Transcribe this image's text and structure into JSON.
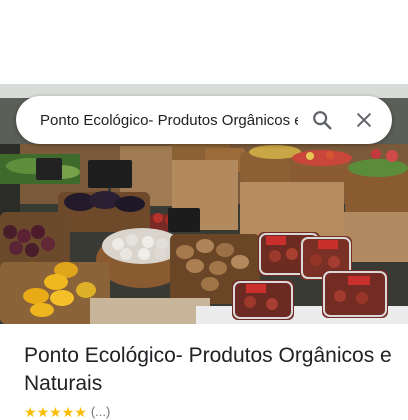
{
  "search": {
    "query": "Ponto Ecológico- Produtos Orgânicos e Naturais",
    "search_icon": "search-icon",
    "close_icon": "close-icon"
  },
  "place": {
    "title": "Ponto Ecológico- Produtos Orgânicos e Naturais",
    "rating_stars": 5,
    "review_count": "(...)"
  },
  "colors": {
    "star": "#fbbc04",
    "text": "#202124",
    "secondary": "#70757a"
  }
}
